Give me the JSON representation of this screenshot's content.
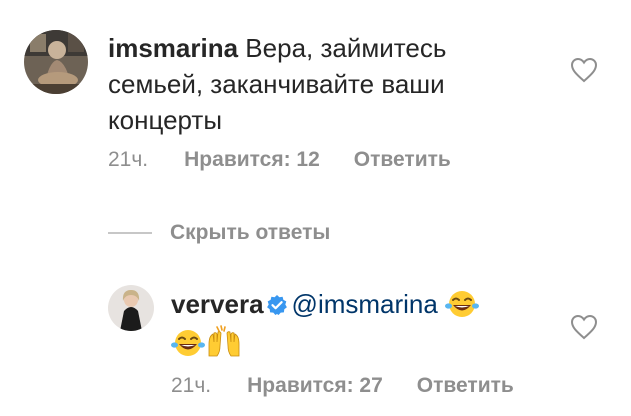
{
  "comments": [
    {
      "username": "imsmarina",
      "text_lines": [
        " Вера, займитесь",
        "семьей, заканчивайте ваши",
        "концерты"
      ],
      "time": "21ч.",
      "likes": "Нравится: 12",
      "reply": "Ответить"
    }
  ],
  "hide_replies": "Скрыть ответы",
  "replies": [
    {
      "username": "ververa",
      "verified_icon": "verified-badge-icon",
      "mention": "@imsmarina",
      "emojis": [
        "face-with-tears-of-joy-icon",
        "face-with-tears-of-joy-icon",
        "raising-hands-icon"
      ],
      "time": "21ч.",
      "likes": "Нравится: 27",
      "reply": "Ответить"
    }
  ],
  "colors": {
    "text": "#262626",
    "secondary": "#8e8e8e",
    "mention": "#003569",
    "verified": "#3897f0",
    "divider": "#c7c7c7"
  }
}
